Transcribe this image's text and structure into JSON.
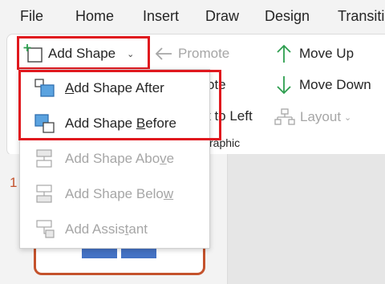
{
  "menubar": {
    "tabs": [
      "File",
      "Home",
      "Insert",
      "Draw",
      "Design",
      "Transiti"
    ]
  },
  "ribbon": {
    "add_shape_label": "Add Shape",
    "promote_label": "Promote",
    "demote_partial": "ote",
    "right_to_left_partial": "t to Left",
    "group_label_partial": "raphic",
    "move_up_label": "Move Up",
    "move_down_label": "Move Down",
    "layout_label": "Layout"
  },
  "dropdown": {
    "items": [
      {
        "pre": "",
        "ul": "A",
        "post": "dd Shape After",
        "enabled": true
      },
      {
        "pre": "Add Shape ",
        "ul": "B",
        "post": "efore",
        "enabled": true
      },
      {
        "pre": "Add Shape Abo",
        "ul": "v",
        "post": "e",
        "enabled": false
      },
      {
        "pre": "Add Shape Belo",
        "ul": "w",
        "post": "",
        "enabled": false
      },
      {
        "pre": "Add Assis",
        "ul": "t",
        "post": "ant",
        "enabled": false
      }
    ]
  },
  "slide_panel": {
    "slide_number": "1"
  },
  "colors": {
    "highlight": "#e0181e",
    "accent_green": "#2e9e4f",
    "shape_blue": "#4472c4",
    "thumb_border": "#c4522c"
  },
  "icons": {
    "add_shape": "add-shape-icon",
    "promote": "arrow-left-icon",
    "move_up": "arrow-up-icon",
    "move_down": "arrow-down-icon",
    "layout": "org-chart-icon"
  }
}
